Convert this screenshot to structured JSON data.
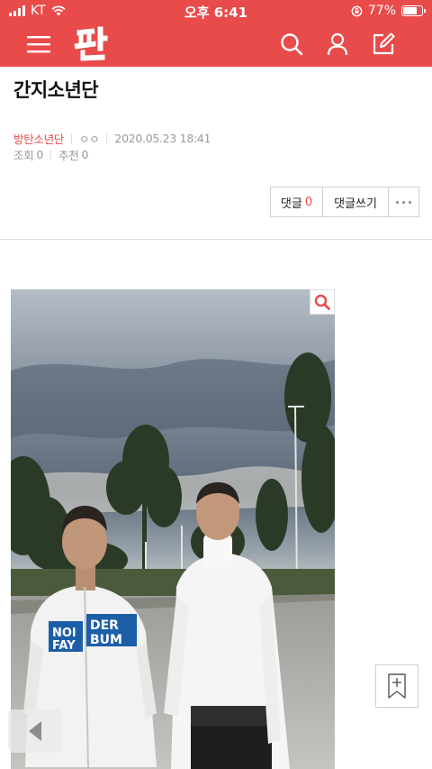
{
  "status_bar": {
    "carrier": "KT",
    "time": "오후 6:41",
    "battery_text": "77%",
    "battery_level": 0.77
  },
  "header": {
    "logo_text": "판",
    "icons": [
      "menu-icon",
      "search-icon",
      "user-icon",
      "compose-icon"
    ]
  },
  "post": {
    "title": "간지소년단",
    "author": "방탄소년단",
    "nickname": "ㅇㅇ",
    "datetime": "2020.05.23 18:41",
    "views_label": "조회",
    "views": "0",
    "likes_label": "추천",
    "likes": "0"
  },
  "actions": {
    "comments_label": "댓글",
    "comments_count": "0",
    "write_comment_label": "댓글쓰기"
  },
  "image": {
    "jacket_text_line1_left": "NOI",
    "jacket_text_line2_left": "FAY",
    "jacket_text_line1_right": "DER",
    "jacket_text_line2_right": "BUM"
  },
  "colors": {
    "brand": "#e94b4b",
    "meta_gray": "#999999",
    "border": "#cfcfcf"
  }
}
